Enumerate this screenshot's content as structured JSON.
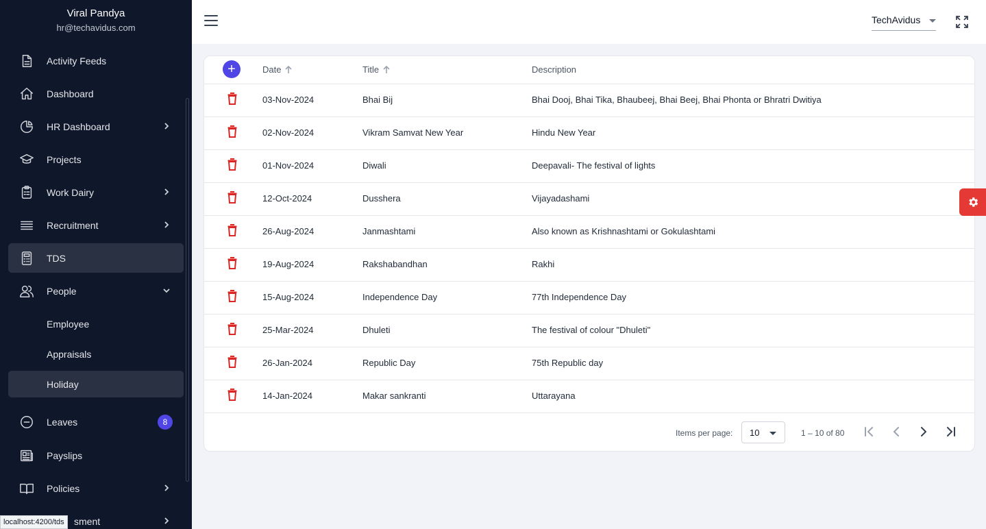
{
  "user": {
    "name": "Viral Pandya",
    "email": "hr@techavidus.com"
  },
  "sidebar": {
    "items": [
      {
        "label": "Activity Feeds",
        "icon": "document-icon"
      },
      {
        "label": "Dashboard",
        "icon": "home-icon"
      },
      {
        "label": "HR Dashboard",
        "icon": "pie-chart-icon"
      },
      {
        "label": "Projects",
        "icon": "graduation-cap-icon"
      },
      {
        "label": "Work Dairy",
        "icon": "clipboard-icon"
      },
      {
        "label": "Recruitment",
        "icon": "lines-icon"
      },
      {
        "label": "TDS",
        "icon": "calculator-icon"
      },
      {
        "label": "People",
        "icon": "users-icon"
      },
      {
        "label": "Employee"
      },
      {
        "label": "Appraisals"
      },
      {
        "label": "Holiday"
      },
      {
        "label": "Leaves",
        "icon": "minus-circle-icon",
        "badge": "8"
      },
      {
        "label": "Payslips",
        "icon": "newspaper-icon"
      },
      {
        "label": "Policies",
        "icon": "book-icon"
      },
      {
        "label": "sment",
        "icon": ""
      }
    ]
  },
  "status_url": "localhost:4200/tds",
  "header": {
    "company": "TechAvidus"
  },
  "table": {
    "columns": [
      "Date",
      "Title",
      "Description"
    ],
    "rows": [
      {
        "date": "03-Nov-2024",
        "title": "Bhai Bij",
        "description": "Bhai Dooj, Bhai Tika, Bhaubeej, Bhai Beej, Bhai Phonta or Bhratri Dwitiya"
      },
      {
        "date": "02-Nov-2024",
        "title": "Vikram Samvat New Year",
        "description": "Hindu New Year"
      },
      {
        "date": "01-Nov-2024",
        "title": "Diwali",
        "description": "Deepavali- The festival of lights"
      },
      {
        "date": "12-Oct-2024",
        "title": "Dusshera",
        "description": "Vijayadashami"
      },
      {
        "date": "26-Aug-2024",
        "title": "Janmashtami",
        "description": "Also known as Krishnashtami or Gokulashtami"
      },
      {
        "date": "19-Aug-2024",
        "title": "Rakshabandhan",
        "description": "Rakhi"
      },
      {
        "date": "15-Aug-2024",
        "title": "Independence Day",
        "description": "77th Independence Day"
      },
      {
        "date": "25-Mar-2024",
        "title": "Dhuleti",
        "description": "The festival of colour \"Dhuleti\""
      },
      {
        "date": "26-Jan-2024",
        "title": "Republic Day",
        "description": "75th Republic day"
      },
      {
        "date": "14-Jan-2024",
        "title": "Makar sankranti",
        "description": "Uttarayana"
      }
    ]
  },
  "paginator": {
    "label": "Items per page:",
    "page_size": "10",
    "range": "1 – 10 of 80"
  },
  "colors": {
    "sidebar_bg": "#0f172a",
    "accent": "#4f46e5",
    "delete": "#dc2626",
    "fab": "#e53935"
  }
}
